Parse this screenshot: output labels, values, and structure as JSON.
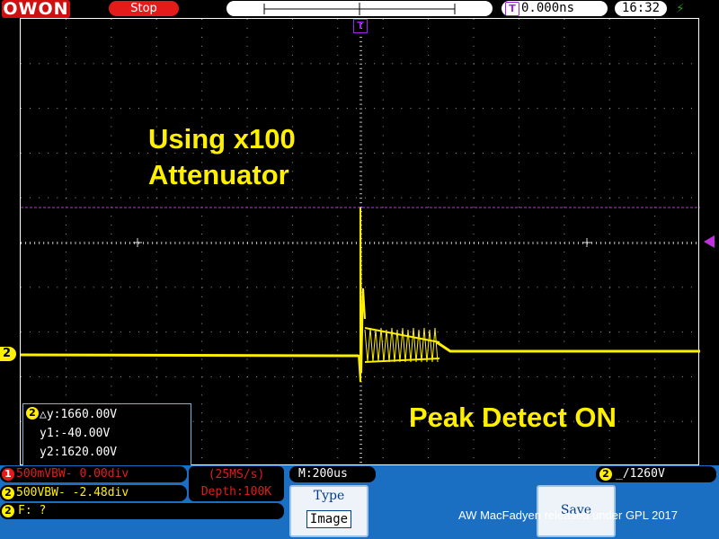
{
  "header": {
    "logo": "OWON",
    "run_state": "Stop",
    "trigger_time": "0.000ns",
    "clock": "16:32",
    "trigger_marker": "T"
  },
  "screen": {
    "channel_marker": "2",
    "annotations": [
      "Using x100",
      "Attenuator",
      "Peak Detect ON"
    ]
  },
  "cursor": {
    "channel": "2",
    "delta_y": "△y:1660.00V",
    "y1": "y1:-40.00V",
    "y2": "y2:1620.00V"
  },
  "status": {
    "ch1": "500mVBW-  0.00div",
    "ch1_badge": "1",
    "ch2": "500VBW-   -2.48div",
    "ch2_badge": "2",
    "sample_rate": "(25MS/s)",
    "depth": "Depth:100K",
    "freq": "F:  ?",
    "freq_badge": "2",
    "timebase": "M:200us",
    "trigger_channel": "2",
    "trigger_level": "1260V"
  },
  "menu": {
    "type_label": "Type",
    "type_value": "Image",
    "save_label": "Save"
  },
  "credit": "AW MacFadyen released under GPL 2017",
  "colors": {
    "ch2_trace": "#ffef00",
    "trigger_line": "#c030e0",
    "bottom_bar": "#1a6fc2"
  },
  "icons": [
    "usb-icon",
    "trigger-rising-edge-icon"
  ]
}
